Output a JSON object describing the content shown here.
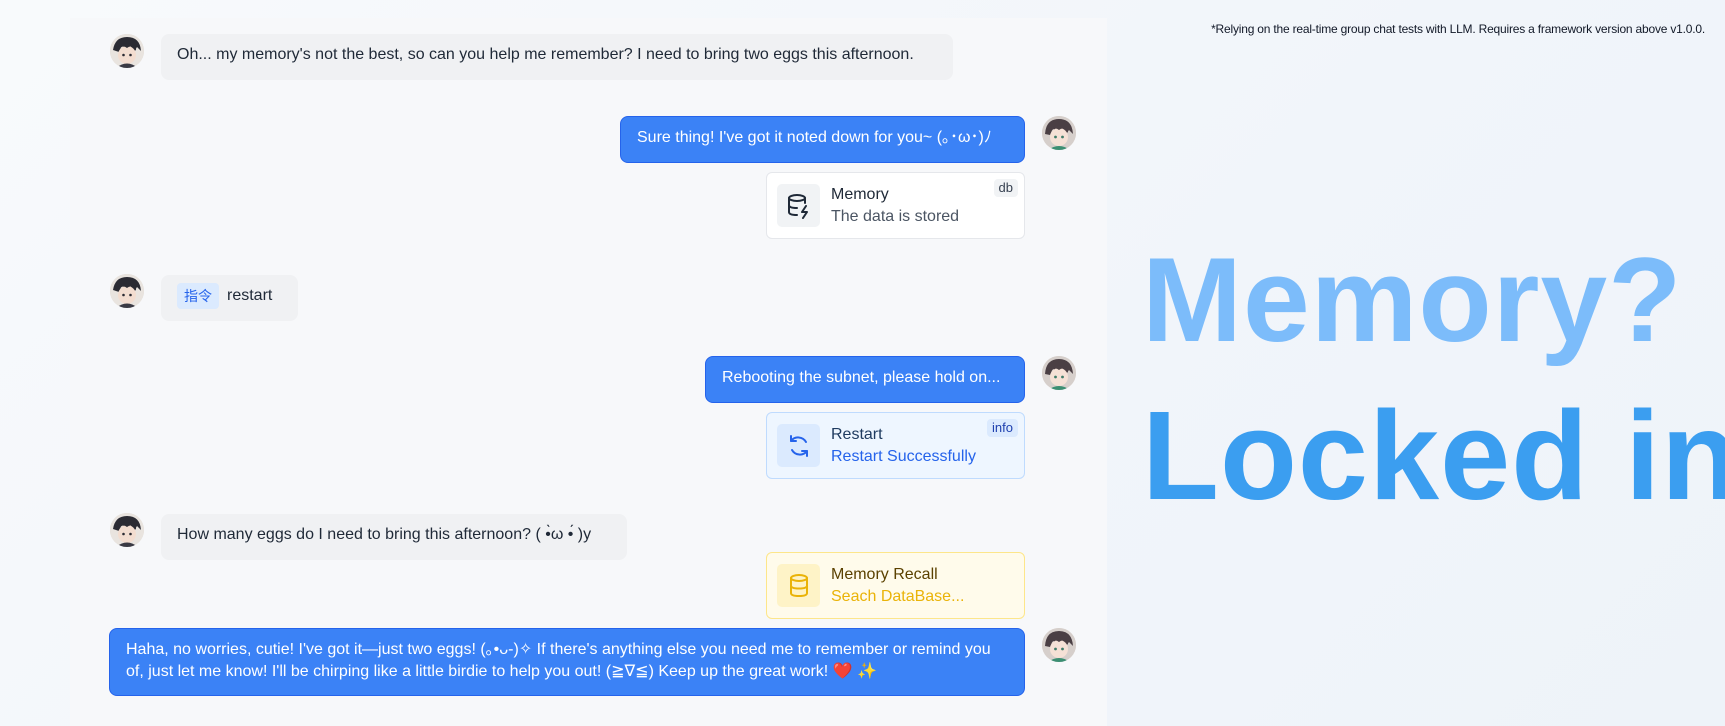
{
  "footnote": "*Relying on the real-time group chat tests with LLM. Requires a framework version above v1.0.0.",
  "hero": {
    "line1": "Memory?",
    "line2": "Locked in"
  },
  "messages": {
    "m1": "Oh... my memory's not the best, so can you help me remember? I need to bring two eggs this afternoon.",
    "m2": "Sure thing! I've got it noted down for you~ (｡･ω･)ﾉ",
    "m3_tag": "指令",
    "m3_text": "restart",
    "m4": "Rebooting the subnet, please hold on...",
    "m5": "How many eggs do I need to bring this afternoon? ( •̀ω •́ )y",
    "m6": "Haha, no worries, cutie! I've got it—just two eggs! (｡•ᴗ-)✧ If there's anything else you need me to remember or remind you of, just let me know! I'll be chirping like a little birdie to help you out! (≧∇≦) Keep up the great work! ❤️ ✨"
  },
  "cards": {
    "memory": {
      "title": "Memory",
      "subtitle": "The data is stored",
      "tag": "db",
      "icon": "database-lightning-icon"
    },
    "restart": {
      "title": "Restart",
      "subtitle": "Restart Successfully",
      "tag": "info",
      "icon": "refresh-icon"
    },
    "recall": {
      "title": "Memory Recall",
      "subtitle": "Seach DataBase...",
      "icon": "database-icon"
    }
  },
  "colors": {
    "bot_bubble": "#3b82f6",
    "hero_line1": "#7cbcfa",
    "hero_line2": "#3b9ef0",
    "info_accent": "#2563eb",
    "recall_accent": "#eab308"
  }
}
